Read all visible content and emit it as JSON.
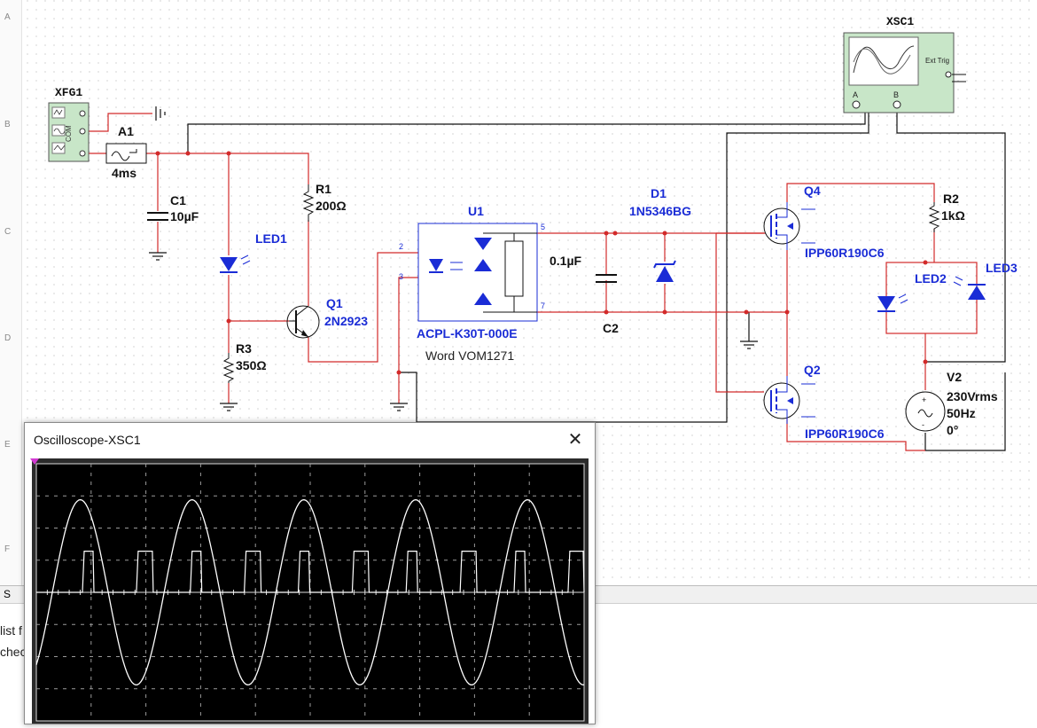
{
  "ruler": {
    "rows": [
      "A",
      "B",
      "C",
      "D",
      "E",
      "F"
    ]
  },
  "schematic": {
    "function_generator": {
      "name": "XFG1",
      "com_label": "COM",
      "terminals": [
        "-",
        "COM",
        "+"
      ]
    },
    "components": [
      {
        "ref": "A1",
        "value": "4ms"
      },
      {
        "ref": "C1",
        "value": "10µF"
      },
      {
        "ref": "R1",
        "value": "200Ω"
      },
      {
        "ref": "LED1",
        "value": ""
      },
      {
        "ref": "Q1",
        "value": "2N2923"
      },
      {
        "ref": "R3",
        "value": "350Ω"
      },
      {
        "ref": "U1",
        "value": "ACPL-K30T-000E",
        "note": "Word VOM1271",
        "pins": [
          "2",
          "3",
          "5",
          "7"
        ]
      },
      {
        "ref": "C2",
        "value": "0.1µF"
      },
      {
        "ref": "D1",
        "value": "1N5346BG"
      },
      {
        "ref": "Q4",
        "value": "IPP60R190C6"
      },
      {
        "ref": "Q2",
        "value": "IPP60R190C6"
      },
      {
        "ref": "R2",
        "value": "1kΩ"
      },
      {
        "ref": "LED2",
        "value": ""
      },
      {
        "ref": "LED3",
        "value": ""
      },
      {
        "ref": "V2",
        "value": "230Vrms",
        "freq": "50Hz",
        "phase": "0°"
      }
    ],
    "oscilloscope_instrument": {
      "name": "XSC1",
      "ext_trig_label": "Ext Trig",
      "channel_a": "A",
      "channel_b": "B"
    },
    "colors": {
      "wire_red": "#d22a2a",
      "wire_black": "#111111",
      "component_blue": "#1a2cd6",
      "instrument_green": "#c8e6c8"
    }
  },
  "scope_window": {
    "title": "Oscilloscope-XSC1",
    "close_icon": "close-icon",
    "trigger_marker_color": "#d23ad2",
    "trace_color": "#ffffff",
    "grid": {
      "columns": 10,
      "rows": 8
    },
    "signals": [
      {
        "name": "sine",
        "cycles_visible": 5
      },
      {
        "name": "pulse",
        "pulses_visible": 10
      }
    ]
  },
  "bottom_panel": {
    "tab_label": "S",
    "line1": "list f",
    "line2": "checl"
  }
}
